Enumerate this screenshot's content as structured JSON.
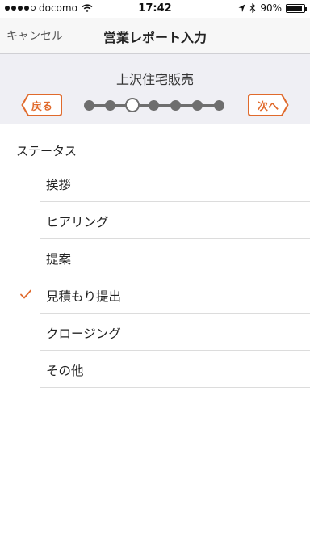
{
  "status_bar": {
    "carrier": "docomo",
    "time": "17:42",
    "battery": "90%"
  },
  "nav": {
    "cancel_label": "キャンセル",
    "title": "営業レポート入力"
  },
  "stepper": {
    "customer_name": "上沢住宅販売",
    "back_label": "戻る",
    "next_label": "次へ",
    "total_steps": 7,
    "current_step": 3
  },
  "section": {
    "label": "ステータス"
  },
  "status_options": [
    {
      "label": "挨拶",
      "selected": false
    },
    {
      "label": "ヒアリング",
      "selected": false
    },
    {
      "label": "提案",
      "selected": false
    },
    {
      "label": "見積もり提出",
      "selected": true
    },
    {
      "label": "クロージング",
      "selected": false
    },
    {
      "label": "その他",
      "selected": false
    }
  ],
  "colors": {
    "accent": "#e06a2c",
    "step": "#6e6e6e"
  }
}
